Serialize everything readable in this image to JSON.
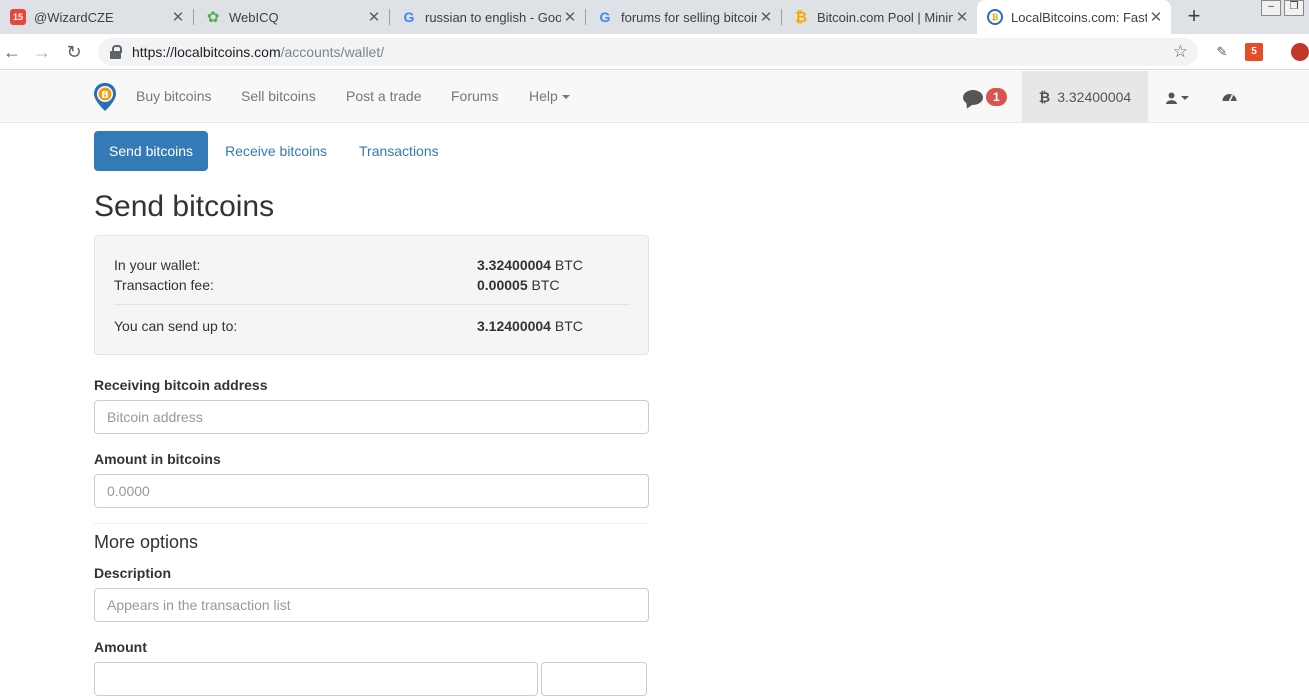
{
  "browser": {
    "tabs": [
      {
        "title": "@WizardCZE",
        "icon": "calendar-icon"
      },
      {
        "title": "WebICQ",
        "icon": "flower-icon"
      },
      {
        "title": "russian to english - Goog",
        "icon": "google-icon"
      },
      {
        "title": "forums for selling bitcoin",
        "icon": "google-icon"
      },
      {
        "title": "Bitcoin.com Pool | Mining",
        "icon": "bitcoin-icon"
      },
      {
        "title": "LocalBitcoins.com: Fastes",
        "icon": "localbitcoins-icon"
      }
    ],
    "url_host": "https://localbitcoins.com",
    "url_path": "/accounts/wallet/"
  },
  "sitenav": {
    "links": [
      "Buy bitcoins",
      "Sell bitcoins",
      "Post a trade",
      "Forums",
      "Help"
    ],
    "notification_count": "1",
    "wallet_balance": "3.32400004"
  },
  "subtabs": [
    "Send bitcoins",
    "Receive bitcoins",
    "Transactions"
  ],
  "page_title": "Send bitcoins",
  "wallet_summary": {
    "in_wallet_label": "In your wallet:",
    "in_wallet_value": "3.32400004",
    "fee_label": "Transaction fee:",
    "fee_value": "0.00005",
    "send_up_to_label": "You can send up to:",
    "send_up_to_value": "3.12400004",
    "unit": "BTC"
  },
  "form": {
    "address_label": "Receiving bitcoin address",
    "address_placeholder": "Bitcoin address",
    "amount_label": "Amount in bitcoins",
    "amount_placeholder": "0.0000",
    "more_options": "More options",
    "description_label": "Description",
    "description_placeholder": "Appears in the transaction list",
    "amount2_label": "Amount"
  },
  "colors": {
    "primary": "#337ab7",
    "badge": "#d9534f",
    "navbar": "#f8f8f8"
  }
}
